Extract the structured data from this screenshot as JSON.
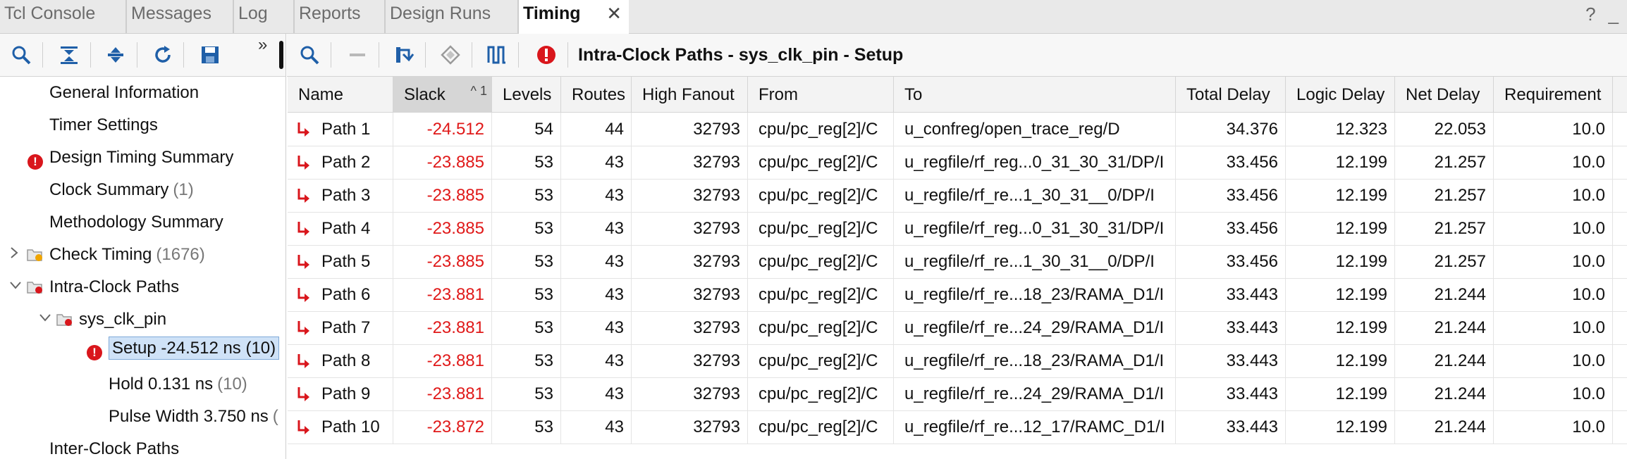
{
  "tabs": [
    {
      "label": "Tcl Console"
    },
    {
      "label": "Messages"
    },
    {
      "label": "Log"
    },
    {
      "label": "Reports"
    },
    {
      "label": "Design Runs"
    },
    {
      "label": "Timing"
    }
  ],
  "window_controls": {
    "help": "?",
    "minimize": "_"
  },
  "toolbar": {
    "title": "Intra-Clock Paths - sys_clk_pin - Setup",
    "overflow": "»",
    "left_icons": [
      "search-icon",
      "collapse-all-icon",
      "expand-all-icon",
      "refresh-icon",
      "save-icon"
    ],
    "right_icons": [
      "search-icon",
      "minus-icon",
      "schematic-icon",
      "diamond-icon",
      "waveform-icon",
      "error-icon"
    ]
  },
  "colors": {
    "error": "#d9161c",
    "negative_slack": "#e01919",
    "icon_blue": "#1f5fa8",
    "selection": "#cfe2f7"
  },
  "tree": {
    "general_information": "General Information",
    "timer_settings": "Timer Settings",
    "design_timing_summary": "Design Timing Summary",
    "clock_summary": "Clock Summary",
    "clock_summary_count": "(1)",
    "methodology_summary": "Methodology Summary",
    "check_timing": "Check Timing",
    "check_timing_count": "(1676)",
    "intra_clock_paths": "Intra-Clock Paths",
    "sys_clk_pin": "sys_clk_pin",
    "setup": "Setup -24.512 ns (10)",
    "hold": "Hold 0.131 ns",
    "hold_count": "(10)",
    "pulse_width": "Pulse Width 3.750 ns",
    "pulse_width_count": "(",
    "inter_clock_paths": "Inter-Clock Paths"
  },
  "table": {
    "sort_indicator": "^ 1",
    "headers": {
      "name": "Name",
      "slack": "Slack",
      "levels": "Levels",
      "routes": "Routes",
      "high_fanout": "High Fanout",
      "from": "From",
      "to": "To",
      "total_delay": "Total Delay",
      "logic_delay": "Logic Delay",
      "net_delay": "Net Delay",
      "requirement": "Requirement"
    },
    "rows": [
      {
        "name": "Path 1",
        "slack": "-24.512",
        "levels": "54",
        "routes": "44",
        "high_fanout": "32793",
        "from": "cpu/pc_reg[2]/C",
        "to": "u_confreg/open_trace_reg/D",
        "total_delay": "34.376",
        "logic_delay": "12.323",
        "net_delay": "22.053",
        "requirement": "10.0"
      },
      {
        "name": "Path 2",
        "slack": "-23.885",
        "levels": "53",
        "routes": "43",
        "high_fanout": "32793",
        "from": "cpu/pc_reg[2]/C",
        "to": "u_regfile/rf_reg...0_31_30_31/DP/I",
        "total_delay": "33.456",
        "logic_delay": "12.199",
        "net_delay": "21.257",
        "requirement": "10.0"
      },
      {
        "name": "Path 3",
        "slack": "-23.885",
        "levels": "53",
        "routes": "43",
        "high_fanout": "32793",
        "from": "cpu/pc_reg[2]/C",
        "to": "u_regfile/rf_re...1_30_31__0/DP/I",
        "total_delay": "33.456",
        "logic_delay": "12.199",
        "net_delay": "21.257",
        "requirement": "10.0"
      },
      {
        "name": "Path 4",
        "slack": "-23.885",
        "levels": "53",
        "routes": "43",
        "high_fanout": "32793",
        "from": "cpu/pc_reg[2]/C",
        "to": "u_regfile/rf_reg...0_31_30_31/DP/I",
        "total_delay": "33.456",
        "logic_delay": "12.199",
        "net_delay": "21.257",
        "requirement": "10.0"
      },
      {
        "name": "Path 5",
        "slack": "-23.885",
        "levels": "53",
        "routes": "43",
        "high_fanout": "32793",
        "from": "cpu/pc_reg[2]/C",
        "to": "u_regfile/rf_re...1_30_31__0/DP/I",
        "total_delay": "33.456",
        "logic_delay": "12.199",
        "net_delay": "21.257",
        "requirement": "10.0"
      },
      {
        "name": "Path 6",
        "slack": "-23.881",
        "levels": "53",
        "routes": "43",
        "high_fanout": "32793",
        "from": "cpu/pc_reg[2]/C",
        "to": "u_regfile/rf_re...18_23/RAMA_D1/I",
        "total_delay": "33.443",
        "logic_delay": "12.199",
        "net_delay": "21.244",
        "requirement": "10.0"
      },
      {
        "name": "Path 7",
        "slack": "-23.881",
        "levels": "53",
        "routes": "43",
        "high_fanout": "32793",
        "from": "cpu/pc_reg[2]/C",
        "to": "u_regfile/rf_re...24_29/RAMA_D1/I",
        "total_delay": "33.443",
        "logic_delay": "12.199",
        "net_delay": "21.244",
        "requirement": "10.0"
      },
      {
        "name": "Path 8",
        "slack": "-23.881",
        "levels": "53",
        "routes": "43",
        "high_fanout": "32793",
        "from": "cpu/pc_reg[2]/C",
        "to": "u_regfile/rf_re...18_23/RAMA_D1/I",
        "total_delay": "33.443",
        "logic_delay": "12.199",
        "net_delay": "21.244",
        "requirement": "10.0"
      },
      {
        "name": "Path 9",
        "slack": "-23.881",
        "levels": "53",
        "routes": "43",
        "high_fanout": "32793",
        "from": "cpu/pc_reg[2]/C",
        "to": "u_regfile/rf_re...24_29/RAMA_D1/I",
        "total_delay": "33.443",
        "logic_delay": "12.199",
        "net_delay": "21.244",
        "requirement": "10.0"
      },
      {
        "name": "Path 10",
        "slack": "-23.872",
        "levels": "53",
        "routes": "43",
        "high_fanout": "32793",
        "from": "cpu/pc_reg[2]/C",
        "to": "u_regfile/rf_re...12_17/RAMC_D1/I",
        "total_delay": "33.443",
        "logic_delay": "12.199",
        "net_delay": "21.244",
        "requirement": "10.0"
      }
    ]
  }
}
